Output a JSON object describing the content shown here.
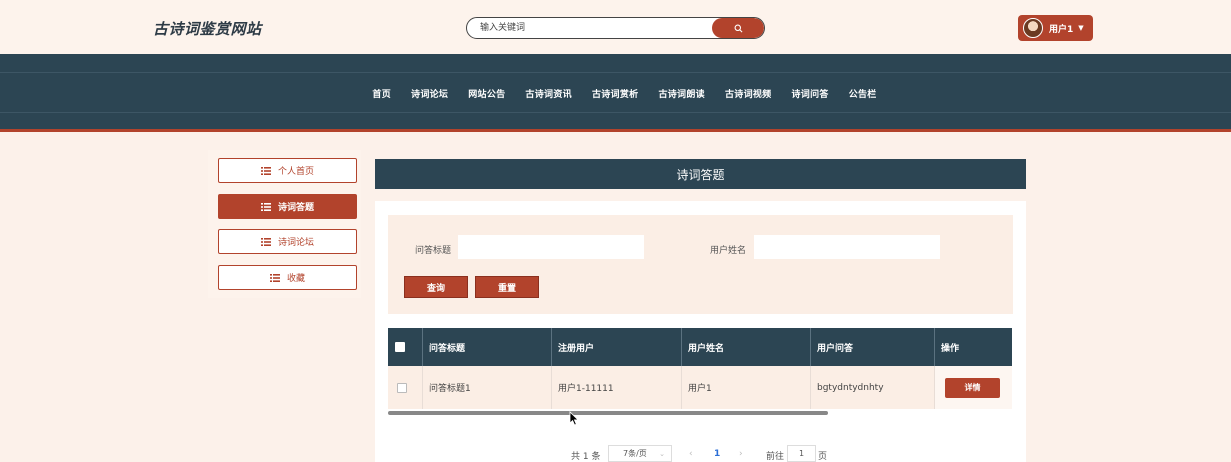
{
  "header": {
    "site_title": "古诗词鉴赏网站",
    "search_placeholder": "输入关键词",
    "user_label": "用户1"
  },
  "nav": {
    "items": [
      "首页",
      "诗词论坛",
      "网站公告",
      "古诗词资讯",
      "古诗词赏析",
      "古诗词朗读",
      "古诗词视频",
      "诗词问答",
      "公告栏"
    ]
  },
  "sidebar": {
    "items": [
      "个人首页",
      "诗词答题",
      "诗词论坛",
      "收藏"
    ],
    "active_index": 1
  },
  "main": {
    "title": "诗词答题",
    "filters": {
      "title_label": "问答标题",
      "name_label": "用户姓名",
      "query_label": "查询",
      "reset_label": "重置"
    },
    "table": {
      "columns": [
        "问答标题",
        "注册用户",
        "用户姓名",
        "用户问答",
        "操作"
      ],
      "rows": [
        {
          "title": "问答标题1",
          "user": "用户1-11111",
          "name": "用户1",
          "answer": "bgtydntydnhty",
          "action": "详情"
        }
      ]
    },
    "pagination": {
      "total": "共 1 条",
      "page_size": "7条/页",
      "current_page": "1",
      "goto_label": "前往",
      "goto_value": "1",
      "page_suffix": "页"
    }
  },
  "colors": {
    "accent": "#b2432c",
    "navy": "#2c4553",
    "background": "#fcf1ea"
  }
}
